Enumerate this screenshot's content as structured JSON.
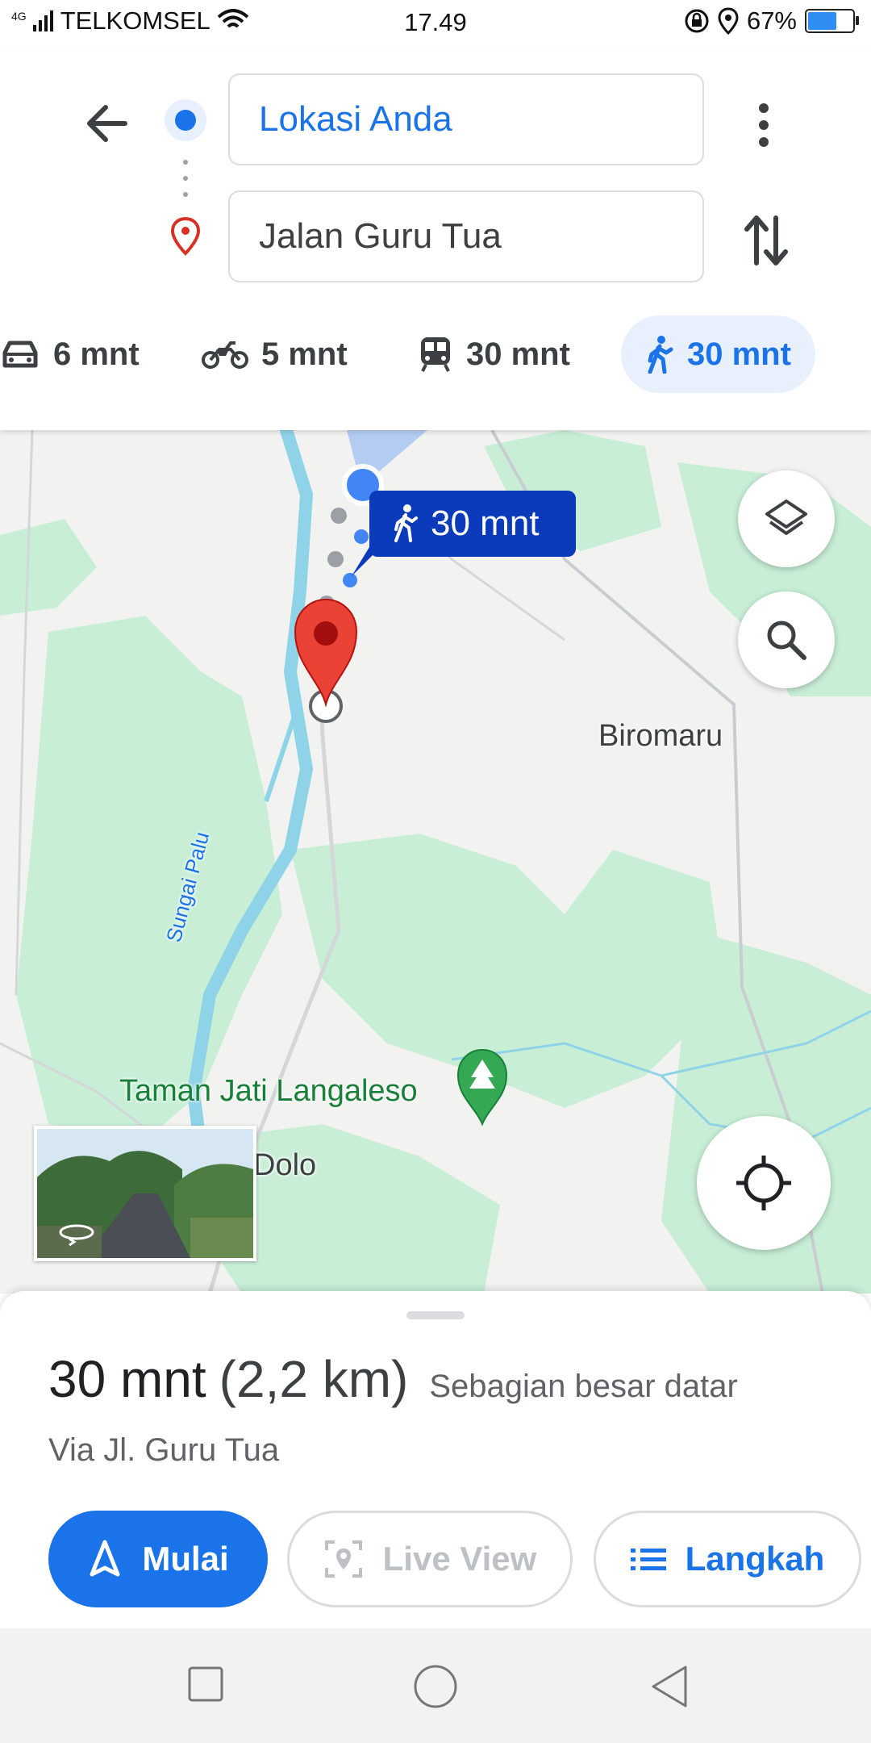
{
  "status": {
    "network": "4G",
    "carrier": "TELKOMSEL",
    "time": "17.49",
    "battery_level": 0.67,
    "battery_label": "67%"
  },
  "header": {
    "origin": "Lokasi Anda",
    "destination": "Jalan Guru Tua",
    "icons": [
      "back-arrow-icon",
      "more-vert-icon",
      "swap-icon",
      "origin-dot-icon",
      "destination-pin-icon"
    ]
  },
  "modes": [
    {
      "name": "car",
      "label": "6 mnt"
    },
    {
      "name": "motorcycle",
      "label": "5 mnt"
    },
    {
      "name": "transit",
      "label": "30 mnt"
    },
    {
      "name": "walk",
      "label": "30 mnt",
      "active": true
    }
  ],
  "map": {
    "route_badge": "30 mnt",
    "labels": {
      "biromaru": "Biromaru",
      "river": "Sungai Palu",
      "park": "Taman Jati Langaleso",
      "dolo": "Dolo"
    },
    "colors": {
      "route": "#4285f4",
      "pin": "#ea4335",
      "water": "#8fd3e8",
      "green": "#c8eed6"
    }
  },
  "summary": {
    "duration": "30 mnt",
    "distance": "(2,2 km)",
    "terrain": "Sebagian besar datar",
    "via": "Via Jl. Guru Tua",
    "start_label": "Mulai",
    "liveview_label": "Live View",
    "steps_label": "Langkah"
  }
}
